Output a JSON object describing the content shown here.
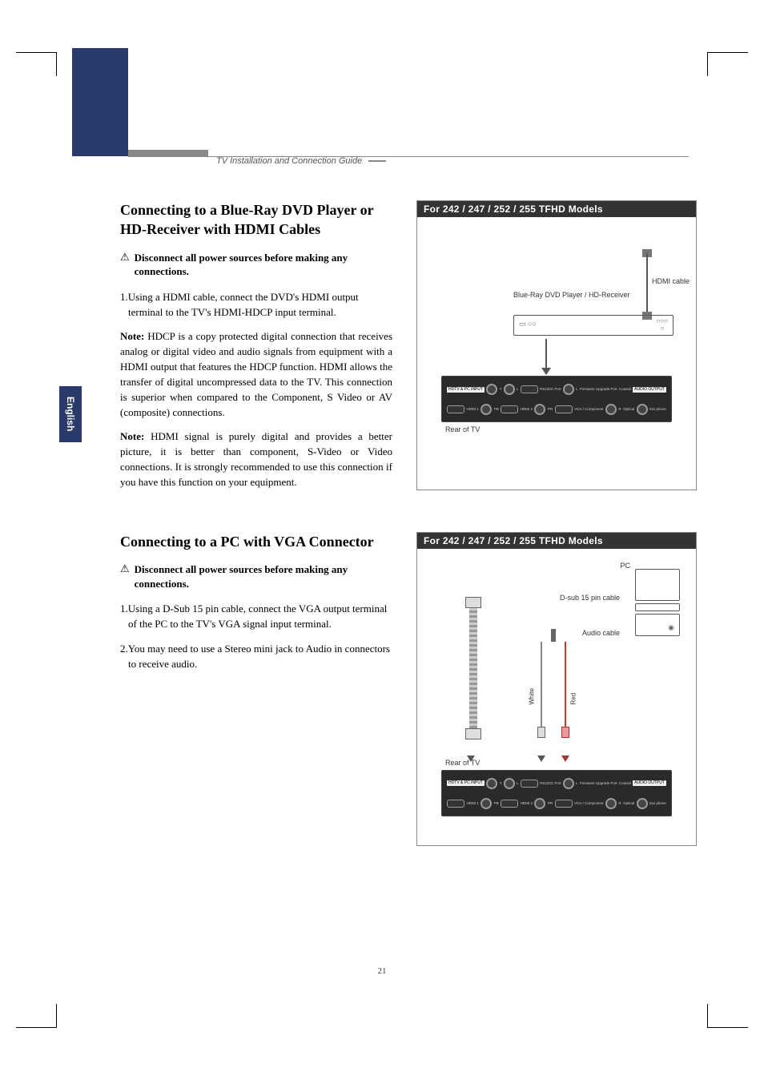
{
  "header": {
    "breadcrumb": "TV Installation and Connection Guide"
  },
  "side_tab": "English",
  "page_number": "21",
  "section1": {
    "title": "Connecting to a Blue-Ray DVD Player or HD-Receiver with HDMI Cables",
    "warning": "Disconnect all power sources before making any connections.",
    "step1": "1.Using a HDMI cable, connect the DVD's HDMI output terminal to the TV's HDMI-HDCP input terminal.",
    "note1": "HDCP is a copy protected digital connection that receives analog or digital video and audio signals from equipment with a HDMI output that features the HDCP function. HDMI allows the transfer of digital uncompressed data to the TV. This connection is superior when compared to the Component, S Video or AV (composite) connections.",
    "note2": "HDMI signal is purely digital and provides a better picture, it is better than component, S-Video or Video connections. It is strongly recommended to use this connection if you have this function on your equipment.",
    "note_label": "Note:",
    "diagram": {
      "title": "For 242 / 247 / 252 / 255 TFHD Models",
      "hdmi_cable": "HDMI cable",
      "player": "Blue-Ray DVD Player / HD-Receiver",
      "rear": "Rear of TV",
      "panel": {
        "hdtv_pc": "HDTV & PC INPUT",
        "audio_out": "AUDIO OUTPUT",
        "y": "Y",
        "l": "L",
        "rs232": "RS232C Port",
        "l2": "L",
        "firmware": "Firmware Upgrade Port",
        "coaxial": "Coaxial",
        "hdmi1": "HDMI 1",
        "pb": "PB",
        "hdmi2": "HDMI 2",
        "pr": "PR",
        "vga": "VGA / Component",
        "r": "R",
        "optical": "Optical",
        "ear": "Ear phone"
      }
    }
  },
  "section2": {
    "title": "Connecting to a PC with VGA Connector",
    "warning": "Disconnect all power sources before making any connections.",
    "step1": "1.Using a D-Sub 15 pin cable, connect the VGA output terminal of the PC to the TV's VGA signal input terminal.",
    "step2": "2.You may need to use a Stereo mini jack to Audio in connectors to receive audio.",
    "diagram": {
      "title": "For 242 / 247 / 252 / 255 TFHD Models",
      "pc": "PC",
      "dsub": "D-sub 15 pin cable",
      "audio_cable": "Audio cable",
      "white": "White",
      "red": "Red",
      "rear": "Rear of TV",
      "panel": {
        "hdtv_pc": "HDTV & PC INPUT",
        "audio_out": "AUDIO OUTPUT",
        "y": "Y",
        "l": "L",
        "rs232": "RS232C Port",
        "l2": "L",
        "firmware": "Firmware Upgrade Port",
        "coaxial": "Coaxial",
        "hdmi1": "HDMI 1",
        "pb": "PB",
        "hdmi2": "HDMI 2",
        "pr": "PR",
        "vga": "VGA / Component",
        "r": "R",
        "optical": "Optical",
        "ear": "Ear phone"
      }
    }
  }
}
